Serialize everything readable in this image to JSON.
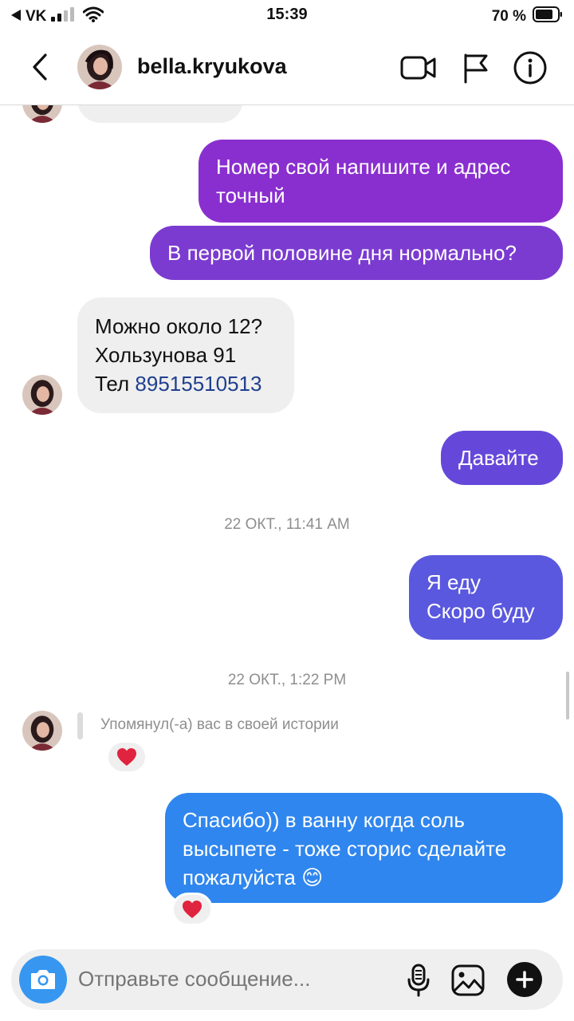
{
  "status_bar": {
    "carrier": "VK",
    "time": "15:39",
    "battery": "70 %"
  },
  "header": {
    "username": "bella.kryukova",
    "icons": [
      "back-chevron-icon",
      "video-call-icon",
      "flag-icon",
      "info-icon"
    ]
  },
  "messages": [
    {
      "side": "out",
      "lines": [
        "Номер свой напишите и адрес",
        "точный"
      ]
    },
    {
      "side": "out",
      "lines": [
        "В первой половине дня нормально?"
      ]
    },
    {
      "side": "in",
      "lines": [
        "Можно около 12?",
        "Хользунова 91"
      ],
      "tel_prefix": "Тел ",
      "tel_number": "89515510513"
    },
    {
      "side": "out",
      "lines": [
        "Давайте"
      ]
    },
    {
      "side": "out",
      "lines": [
        "Я еду",
        "Скоро буду"
      ]
    },
    {
      "side": "out",
      "lines": [
        "Спасибо)) в ванну когда соль",
        "высыпете - тоже сторис сделайте",
        "пожалуйста 😊"
      ],
      "reaction": "❤️"
    }
  ],
  "timestamps": [
    "22 ОКТ., 11:41 AM",
    "22 ОКТ., 1:22 PM"
  ],
  "story_mention": {
    "text": "Упомянул(-а) вас в своей истории",
    "reaction": "❤️"
  },
  "composer": {
    "placeholder": "Отправьте сообщение..."
  },
  "colors": {
    "purple_top": "#8a2fcf",
    "purple_mid": "#7b3bd0",
    "violet": "#6548da",
    "indigo": "#5a58de",
    "blue": "#2f86ee",
    "incoming": "#efefef",
    "camera_button": "#3797f0"
  }
}
